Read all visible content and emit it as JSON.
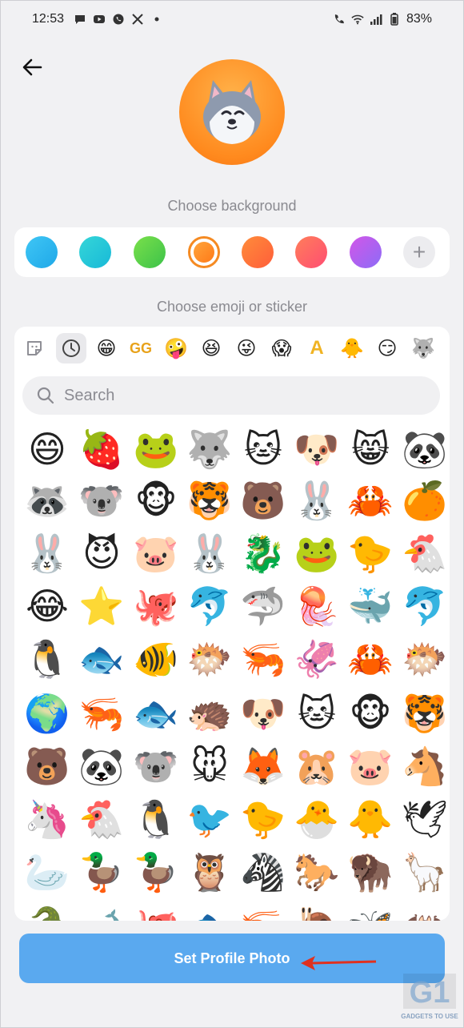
{
  "status_bar": {
    "time": "12:53",
    "battery": "83%",
    "left_icons": [
      "chat-icon",
      "youtube-icon",
      "whatsapp-icon",
      "x-icon",
      "dot-icon"
    ],
    "right_icons": [
      "call-icon",
      "wifi-icon",
      "signal-icon",
      "battery-icon"
    ]
  },
  "header": {
    "back_icon": "back-arrow-icon"
  },
  "avatar": {
    "emoji": "husky-face-sticker"
  },
  "background_section": {
    "label": "Choose background",
    "swatches": [
      "#2fb8ef",
      "#22c9d6",
      "#55d44a",
      "#ff8a1e",
      "#ff6a3a",
      "#ff5a6e",
      "#b35cf2"
    ],
    "selected_index": 3,
    "add_label": "+"
  },
  "emoji_section": {
    "label": "Choose emoji or sticker",
    "tabs": [
      "sticker-icon",
      "recent-icon",
      "😁",
      "GG",
      "🤪",
      "😆",
      "😜",
      "😱",
      "A",
      "🐥",
      "😏",
      "🐺"
    ],
    "search_placeholder": "Search",
    "rows": [
      [
        "😄",
        "🍓",
        "🐸",
        "🐺",
        "🐱",
        "🐶",
        "😸",
        "🐼"
      ],
      [
        "🦝",
        "🐨",
        "🐵",
        "🐯",
        "🐻",
        "🐰",
        "🦀",
        "🍊"
      ],
      [
        "🐰",
        "😈",
        "🐷",
        "🐰",
        "🐉",
        "🐸",
        "🐤",
        "🐔"
      ],
      [
        "😂",
        "⭐",
        "🐙",
        "🐬",
        "🦈",
        "🪼",
        "🐳",
        "🐬"
      ],
      [
        "🐧",
        "🐟",
        "🐠",
        "🐡",
        "🦐",
        "🦑",
        "🦀",
        "🐡"
      ],
      [
        "🌍",
        "🦐",
        "🐟",
        "🦔",
        "🐶",
        "🐱",
        "🐵",
        "🐯"
      ],
      [
        "🐻",
        "🐼",
        "🐨",
        "🐭",
        "🦊",
        "🐹",
        "🐷",
        "🐴"
      ],
      [
        "🦄",
        "🐔",
        "🐧",
        "🐦",
        "🐤",
        "🐣",
        "🐥",
        "🕊"
      ],
      [
        "🦢",
        "🦆",
        "🦆",
        "🦉",
        "🦓",
        "🐎",
        "🦬",
        "🦙"
      ],
      [
        "🐊",
        "🐋",
        "🐙",
        "🐟",
        "🦐",
        "🐌",
        "🦋",
        "🦇"
      ]
    ]
  },
  "action": {
    "button_label": "Set Profile Photo"
  },
  "watermark": {
    "text": "GADGETS TO USE",
    "logo": "G1"
  }
}
